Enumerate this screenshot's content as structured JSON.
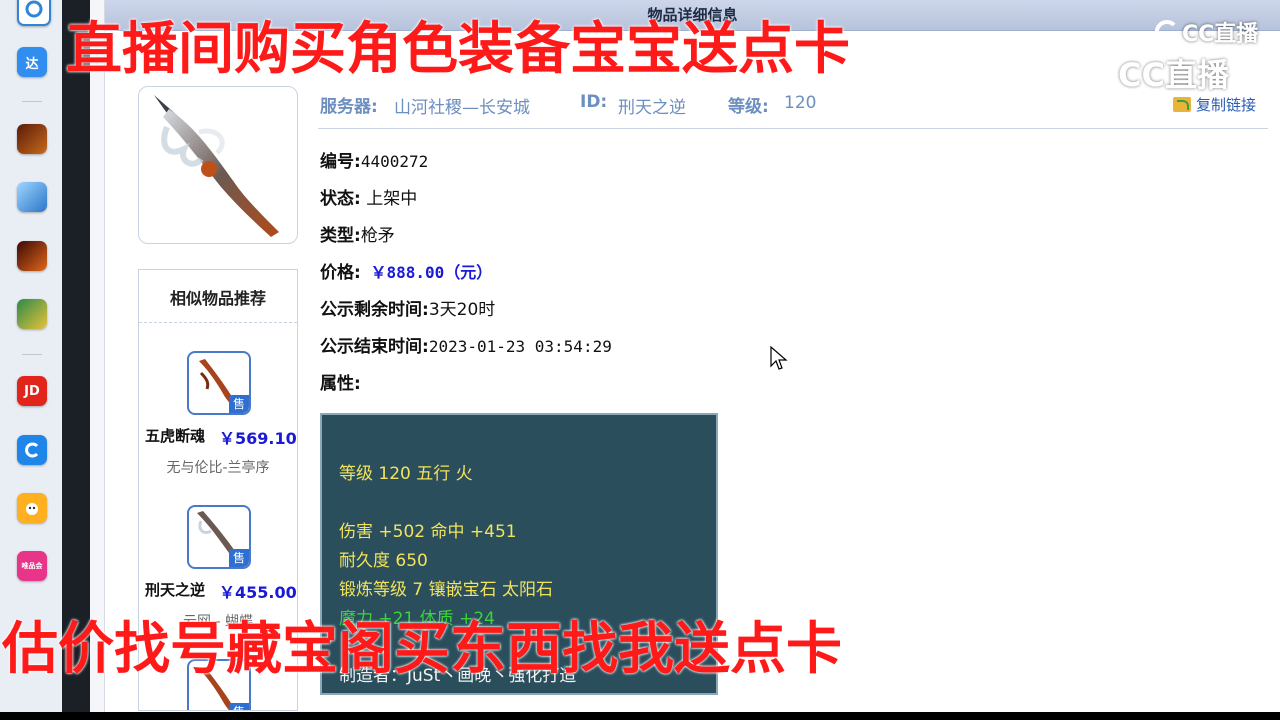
{
  "panel_title": "物品详细信息",
  "header": {
    "server_label": "服务器:",
    "server_value": "山河社稷—长安城",
    "id_label": "ID:",
    "id_value": "刑天之逆",
    "level_label": "等级:",
    "level_value": "120",
    "copy_link": "复制链接"
  },
  "details": [
    {
      "label": "编号:",
      "value": "4400272"
    },
    {
      "label": "状态:",
      "value": " 上架中"
    },
    {
      "label": "类型:",
      "value": "枪矛"
    },
    {
      "label": "价格:",
      "value": " ￥888.00（元）"
    },
    {
      "label": "公示剩余时间:",
      "value": "3天20时"
    },
    {
      "label": "公示结束时间:",
      "value": "2023-01-23 03:54:29"
    },
    {
      "label": "属性:",
      "value": ""
    }
  ],
  "attributes": {
    "lines": [
      "等级 120 五行 火",
      "伤害 +502 命中 +451",
      "耐久度 650",
      "锻炼等级 7 镶嵌宝石 太阳石",
      "魔力 +21 体质 +24",
      "制造者：JuSt丶画晚丶强化打造"
    ]
  },
  "similar": {
    "title": "相似物品推荐",
    "sold_badge": "售",
    "items": [
      {
        "name": "五虎断魂",
        "price": "￥569.10",
        "server": "无与伦比-兰亭序"
      },
      {
        "name": "刑天之逆",
        "price": "￥455.00",
        "server": "云网 - 蝴蝶"
      },
      {
        "name": "",
        "price": "",
        "server": ""
      }
    ]
  },
  "overlays": {
    "top_text": "直播间购买角色装备宝宝送点卡",
    "bottom_text": "估价找号藏宝阁买东西找我送点卡",
    "watermark_small": "CC直播",
    "watermark_large": "CC直播"
  },
  "dock": {
    "icons": [
      "app-icon-1",
      "da-icon",
      "game-icon-1",
      "game-icon-2",
      "bao-icon",
      "game-icon-3",
      "jd-icon",
      "cc-icon",
      "pet-icon",
      "shop-icon"
    ],
    "da_label": "达",
    "jd_label": "JD",
    "shop_label": "唯品会"
  },
  "colors": {
    "overlay_red": "#ff1a1a",
    "price_blue": "#1a1ad6",
    "attr_bg": "#2a4e5c",
    "attr_yellow": "#f3e35b",
    "attr_green": "#3cd23c"
  }
}
